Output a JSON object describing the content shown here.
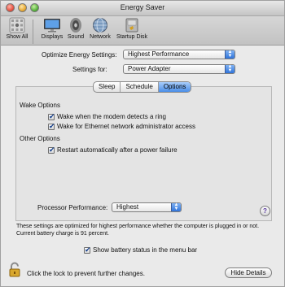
{
  "window": {
    "title": "Energy Saver"
  },
  "toolbar": {
    "items": [
      {
        "label": "Show All",
        "icon": "apple-grid-icon"
      },
      {
        "label": "Displays",
        "icon": "display-icon"
      },
      {
        "label": "Sound",
        "icon": "speaker-icon"
      },
      {
        "label": "Network",
        "icon": "globe-icon"
      },
      {
        "label": "Startup Disk",
        "icon": "disk-icon"
      }
    ]
  },
  "settings": {
    "optimize_label": "Optimize Energy Settings:",
    "optimize_value": "Highest Performance",
    "for_label": "Settings for:",
    "for_value": "Power Adapter"
  },
  "tabs": [
    {
      "label": "Sleep",
      "active": false
    },
    {
      "label": "Schedule",
      "active": false
    },
    {
      "label": "Options",
      "active": true
    }
  ],
  "options": {
    "wake_heading": "Wake Options",
    "wake_modem": {
      "label": "Wake when the modem detects a ring",
      "checked": true
    },
    "wake_ethernet": {
      "label": "Wake for Ethernet network administrator access",
      "checked": true
    },
    "other_heading": "Other Options",
    "restart": {
      "label": "Restart automatically after a power failure",
      "checked": true
    },
    "processor_label": "Processor Performance:",
    "processor_value": "Highest"
  },
  "note": {
    "line1": "These settings are optimized for highest performance whether the computer is plugged in or not.",
    "line2": "Current battery charge is 91 percent."
  },
  "battery_status": {
    "label": "Show battery status in the menu bar",
    "checked": true
  },
  "footer": {
    "lock_text": "Click the lock to prevent further changes.",
    "hide_details": "Hide Details"
  },
  "colors": {
    "accent": "#4a8ee8",
    "window_bg": "#eaeaea"
  }
}
